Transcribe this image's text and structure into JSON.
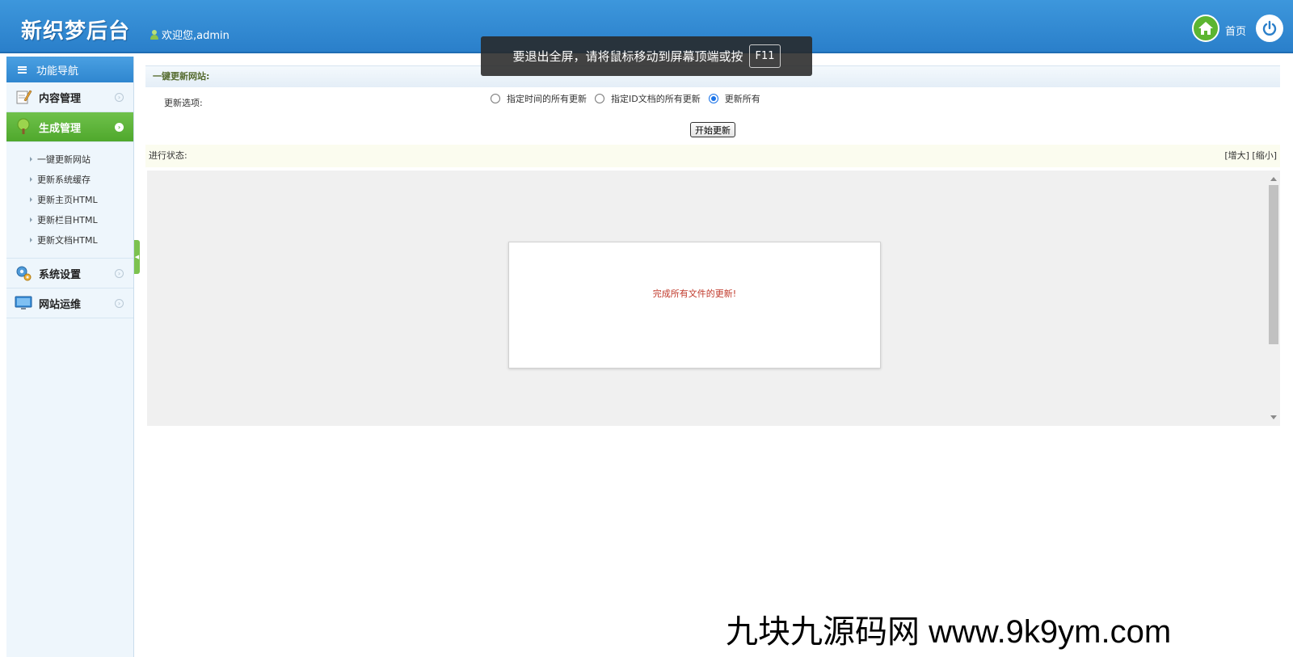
{
  "header": {
    "logo": "新织梦后台",
    "welcome": "欢迎您,admin",
    "home_label": "首页"
  },
  "toast": {
    "message": "要退出全屏，请将鼠标移动到屏幕顶端或按",
    "key": "F11"
  },
  "sidebar": {
    "title": "功能导航",
    "groups": [
      {
        "label": "内容管理",
        "icon": "pencil-notepad-icon"
      },
      {
        "label": "生成管理",
        "icon": "tree-icon",
        "active": true
      },
      {
        "label": "系统设置",
        "icon": "gears-icon"
      },
      {
        "label": "网站运维",
        "icon": "monitor-icon"
      }
    ],
    "sub_items": [
      "一键更新网站",
      "更新系统缓存",
      "更新主页HTML",
      "更新栏目HTML",
      "更新文档HTML"
    ]
  },
  "main": {
    "section_title": "一键更新网站:",
    "option_label": "更新选项:",
    "radios": [
      {
        "label": "指定时间的所有更新",
        "checked": false
      },
      {
        "label": "指定ID文档的所有更新",
        "checked": false
      },
      {
        "label": "更新所有",
        "checked": true
      }
    ],
    "start_button": "开始更新",
    "status_label": "进行状态:",
    "zoom_in": "[增大]",
    "zoom_out": "[缩小]",
    "result_message": "完成所有文件的更新!"
  },
  "watermark": "九块九源码网 www.9k9ym.com",
  "colors": {
    "header_blue": "#2a7fca",
    "active_green": "#4fa82c",
    "message_red": "#c0392b"
  }
}
